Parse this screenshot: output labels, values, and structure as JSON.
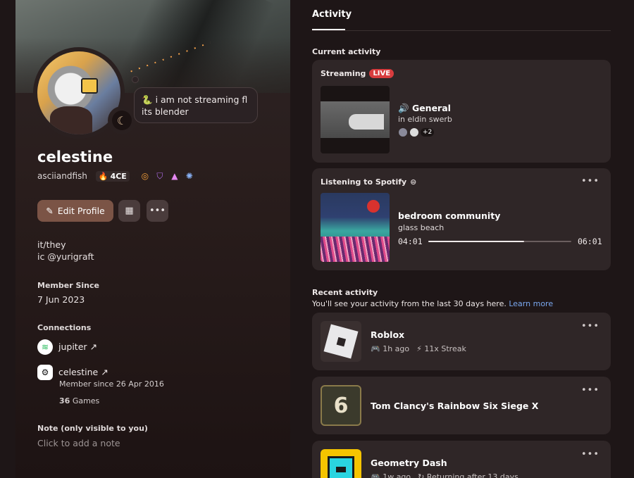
{
  "profile": {
    "status_text": "i am not streaming fl its blender",
    "display_name": "celestine",
    "username": "asciiandfish",
    "tag": "4CE",
    "edit_label": "Edit Profile",
    "pronouns": "it/they",
    "bio_line": "ic @yurigraft",
    "member_since_label": "Member Since",
    "member_since": "7 Jun 2023",
    "connections_label": "Connections",
    "connections": [
      {
        "name": "jupiter ↗",
        "service": "spotify-icon"
      },
      {
        "name": "celestine ↗",
        "service": "steam-icon",
        "sub": "Member since 26 Apr 2016",
        "games_count": "36",
        "games_label": "Games"
      }
    ],
    "note_label": "Note (only visible to you)",
    "note_placeholder": "Click to add a note"
  },
  "activity": {
    "tab_label": "Activity",
    "current_label": "Current activity",
    "streaming": {
      "title": "Streaming",
      "live": "LIVE",
      "channel": "General",
      "server": "in eldin swerb",
      "extra_viewers": "+2"
    },
    "spotify": {
      "title": "Listening to Spotify",
      "song": "bedroom community",
      "artist": "glass beach",
      "elapsed": "04:01",
      "duration": "06:01",
      "progress": 0.67
    },
    "recent_label": "Recent activity",
    "recent_sub": "You'll see your activity from the last 30 days here.",
    "learn_more": "Learn more",
    "recent": [
      {
        "name": "Roblox",
        "meta1": "1h ago",
        "meta2": "11x Streak"
      },
      {
        "name": "Tom Clancy's Rainbow Six Siege X"
      },
      {
        "name": "Geometry Dash",
        "meta1": "1w ago",
        "meta2": "Returning after 13 days"
      }
    ],
    "more": "•••"
  },
  "colors": {
    "accent_button": "#7b5446",
    "live": "#d83c3e",
    "link": "#7aa8f0"
  }
}
